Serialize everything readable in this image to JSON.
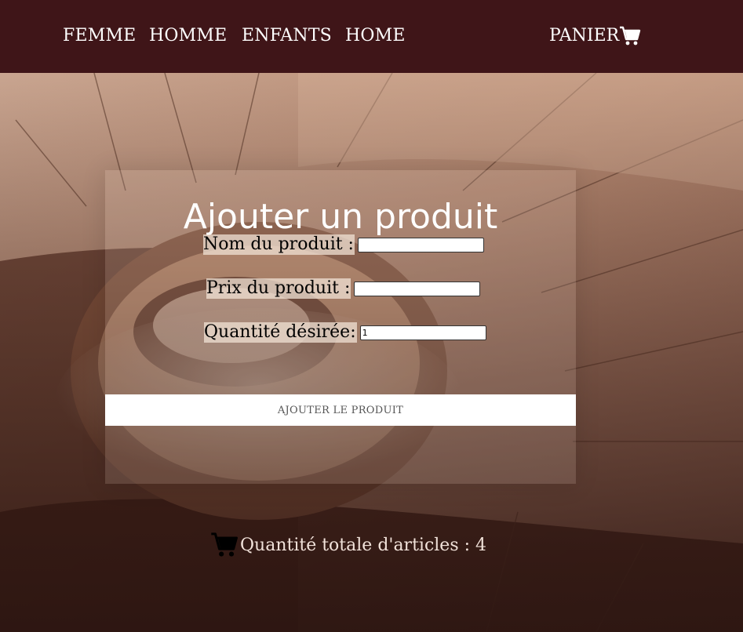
{
  "nav": {
    "items": [
      {
        "label": "FEMME"
      },
      {
        "label": "HOMME"
      },
      {
        "label": "ENFANTS"
      },
      {
        "label": "HOME"
      }
    ],
    "cart_label": "PANIER",
    "cart_icon": "cart-icon"
  },
  "form": {
    "title": "Ajouter un produit",
    "fields": [
      {
        "label": "Nom du produit :",
        "value": ""
      },
      {
        "label": "Prix du produit :",
        "value": ""
      },
      {
        "label": "Quantité désirée:",
        "value": "1"
      }
    ],
    "submit_label": "AJOUTER LE PRODUIT"
  },
  "footer": {
    "total_label": "Quantité totale d'articles : 4"
  },
  "colors": {
    "navbar": "#3f1518",
    "text_light": "#ffffff",
    "button_bg": "#ffffff"
  }
}
